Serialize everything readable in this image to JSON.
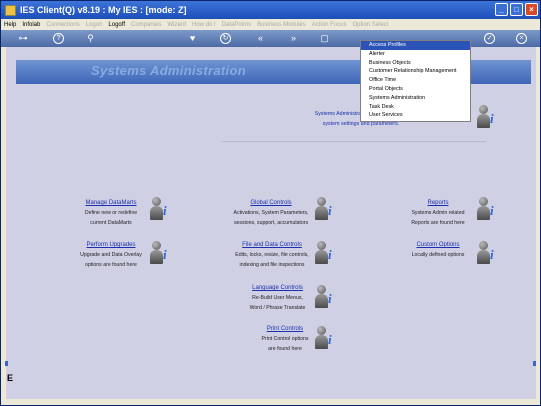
{
  "window": {
    "title": "IES Client(Q) v8.19 : My IES : [mode: Z]"
  },
  "menubar": {
    "items": [
      {
        "label": "Help",
        "disabled": false
      },
      {
        "label": "Infolab",
        "disabled": false
      },
      {
        "label": "Connections",
        "disabled": true
      },
      {
        "label": "Logon",
        "disabled": true
      },
      {
        "label": "Logoff",
        "disabled": false
      },
      {
        "label": "Companies",
        "disabled": true
      },
      {
        "label": "Wizard",
        "disabled": true
      },
      {
        "label": "How do I",
        "disabled": true
      },
      {
        "label": "DataPoints",
        "disabled": true
      },
      {
        "label": "Business Modules",
        "disabled": true
      },
      {
        "label": "Action Focus",
        "disabled": true
      },
      {
        "label": "Option Select",
        "disabled": true
      }
    ]
  },
  "banner": {
    "title": "Systems Administration"
  },
  "intro": {
    "line1": "Systems Administration is for managing",
    "line2": "system settings and parameters."
  },
  "sections": {
    "manage_datamarts": {
      "title": "Manage DataMarts",
      "line1": "Define new or redefine",
      "line2": "current DataMarts"
    },
    "perform_upgrades": {
      "title": "Perform Upgrades",
      "line1": "Upgrade and Data Overlay",
      "line2": "options are found here"
    },
    "global_controls": {
      "title": "Global Controls",
      "line1": "Activations, System Parameters,",
      "line2": "sessions, support, accumulators"
    },
    "file_data_controls": {
      "title": "File and Data Controls",
      "line1": "Edits, locks, resize, file controls,",
      "line2": "indexing and file inspections"
    },
    "language_controls": {
      "title": "Language Controls",
      "line1": "Re-Build User Menus,",
      "line2": "Word / Phrase Translate"
    },
    "print_controls": {
      "title": "Print Controls",
      "line1": "Print Control options",
      "line2": "are found here"
    },
    "reports": {
      "title": "Reports",
      "line1": "Systems Admin related",
      "line2": "Reports are found here"
    },
    "custom_options": {
      "title": "Custom Options",
      "line1": "Locally defined options",
      "line2": ""
    }
  },
  "dropdown": {
    "selected_index": 0,
    "options": [
      "Access Profiles",
      "Alerter",
      "Business Objects",
      "Customer Relationship Management",
      "Office Time",
      "Portal Objects",
      "Systems Administration",
      "Task Desk",
      "User Services"
    ]
  },
  "side_tab": {
    "label": "E"
  },
  "colors": {
    "titlebar": "#1c4fb8",
    "toolbar": "#5a76b0",
    "banner": "#4f75c2",
    "content_bg": "#cfd0e3",
    "link": "#1c2fb0",
    "dropdown_selected": "#2c54b8"
  }
}
